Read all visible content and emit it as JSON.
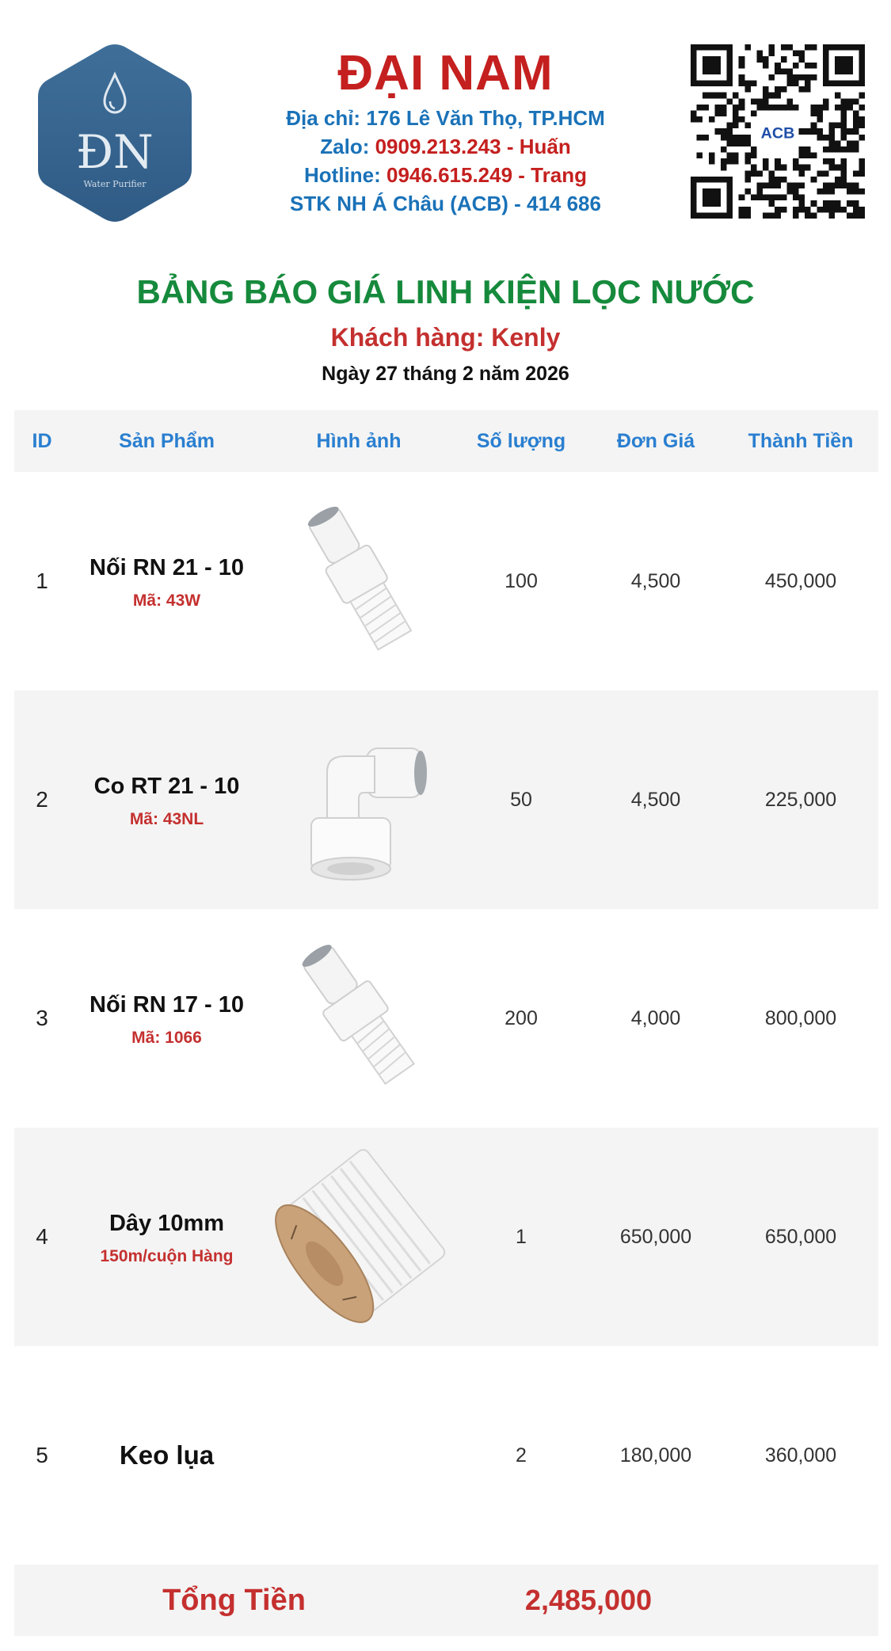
{
  "company": {
    "name": "ĐẠI NAM",
    "logo_text": "ĐN",
    "logo_subtext": "Water Purifier",
    "address_label": "Địa chỉ: 176 Lê Văn Thọ, TP.HCM",
    "zalo_label": "Zalo:",
    "zalo_value": "0909.213.243 - Huấn",
    "hotline_label": "Hotline:",
    "hotline_value": "0946.615.249 - Trang",
    "bank_label": "STK NH Á Châu (ACB) - 414 686",
    "qr_badge": "ACB"
  },
  "document": {
    "title": "BẢNG BÁO GIÁ LINH KIỆN LỌC NƯỚC",
    "customer": "Khách hàng: Kenly",
    "date": "Ngày 27 tháng 2 năm 2026"
  },
  "table": {
    "headers": [
      "ID",
      "Sản Phẩm",
      "Hình ảnh",
      "Số lượng",
      "Đơn Giá",
      "Thành Tiền"
    ],
    "rows": [
      {
        "id": "1",
        "name": "Nối RN 21 - 10",
        "code": "Mã: 43W",
        "image": "straight-connector",
        "qty": "100",
        "price": "4,500",
        "total": "450,000"
      },
      {
        "id": "2",
        "name": "Co RT 21 - 10",
        "code": "Mã: 43NL",
        "image": "elbow-connector",
        "qty": "50",
        "price": "4,500",
        "total": "225,000"
      },
      {
        "id": "3",
        "name": "Nối RN 17 - 10",
        "code": "Mã: 1066",
        "image": "straight-connector",
        "qty": "200",
        "price": "4,000",
        "total": "800,000"
      },
      {
        "id": "4",
        "name": "Dây 10mm",
        "code": "150m/cuộn Hàng",
        "image": "tube-coil",
        "qty": "1",
        "price": "650,000",
        "total": "650,000"
      },
      {
        "id": "5",
        "name": "Keo lụa",
        "code": "",
        "image": "",
        "qty": "2",
        "price": "180,000",
        "total": "360,000"
      }
    ],
    "total_label": "Tổng Tiền",
    "total_value": "2,485,000"
  },
  "colors": {
    "brand_red": "#c4201f",
    "info_blue": "#1a72b8",
    "title_green": "#168a3c",
    "header_blue": "#2a7fd0"
  }
}
